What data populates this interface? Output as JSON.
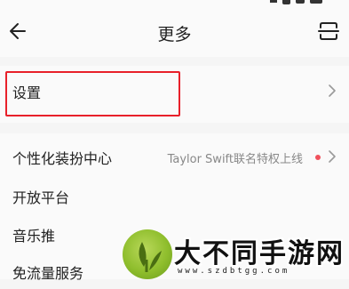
{
  "header": {
    "title": "更多",
    "back_icon": "arrow-left-icon",
    "scan_icon": "scan-icon"
  },
  "menu": {
    "settings": {
      "label": "设置",
      "chevron_icon": "chevron-right-icon"
    },
    "personal_center": {
      "label": "个性化装扮中心",
      "promo": "Taylor Swift联名特权上线",
      "dot_color": "#f0515c",
      "chevron_icon": "chevron-right-icon"
    },
    "open_platform": {
      "label": "开放平台"
    },
    "music_push": {
      "label": "音乐推"
    },
    "free_data": {
      "label": "免流量服务"
    }
  },
  "highlight_color": "#e8202a",
  "watermark": {
    "title": "大不同手游网",
    "url": "www.szdbtgg.com"
  }
}
